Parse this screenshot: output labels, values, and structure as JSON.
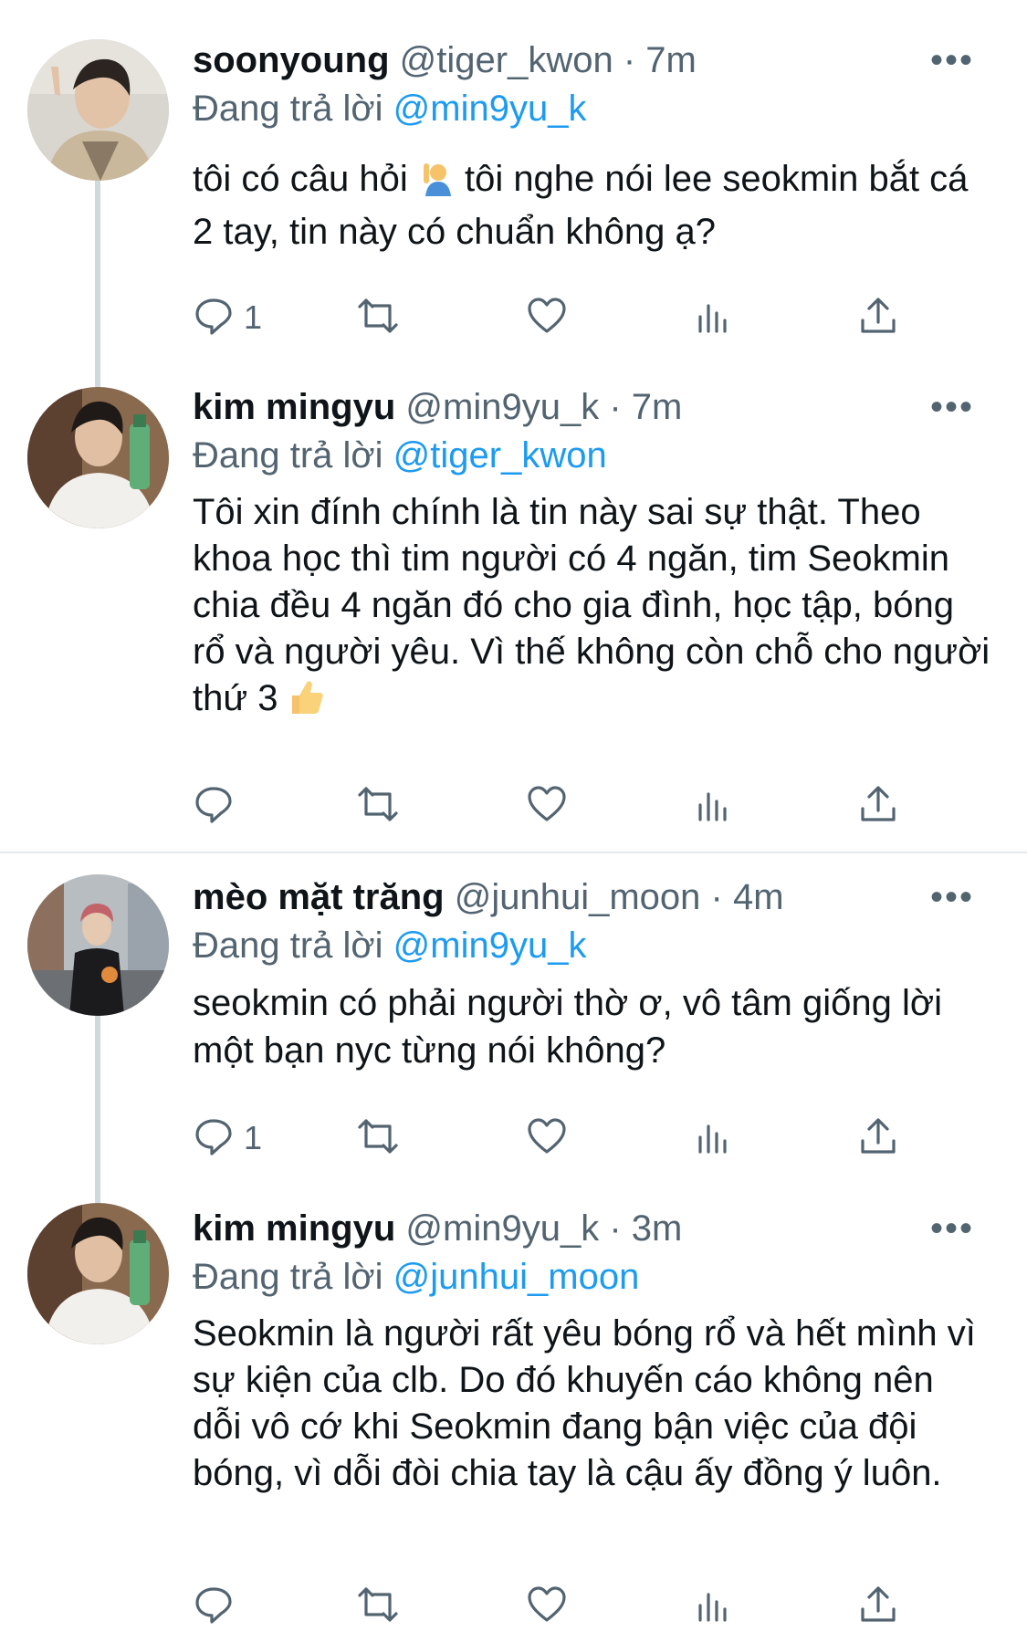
{
  "tweets": [
    {
      "name": "soonyoung",
      "handle": "@tiger_kwon",
      "sep": "·",
      "time": "7m",
      "reply_prefix": "Đang trả lời",
      "reply_to": "@min9yu_k",
      "text_a": "tôi có câu hỏi",
      "text_b": " tôi nghe nói lee seokmin bắt cá 2 tay, tin này có chuẩn không ạ?",
      "emoji": "person-raising-hand-emoji",
      "reply_count": "1",
      "more": "•••"
    },
    {
      "name": "kim mingyu",
      "handle": "@min9yu_k",
      "sep": "·",
      "time": "7m",
      "reply_prefix": "Đang trả lời",
      "reply_to": "@tiger_kwon",
      "text_a": "Tôi xin đính chính là tin này sai sự thật. Theo khoa học thì tim người có 4 ngăn, tim Seokmin chia đều 4 ngăn đó cho gia đình, học tập, bóng rổ và người yêu. Vì thế không còn chỗ cho người thứ 3",
      "text_b": "",
      "emoji": "thumbs-up-emoji",
      "reply_count": "",
      "more": "•••"
    },
    {
      "name": "mèo mặt trăng",
      "handle": "@junhui_moon",
      "sep": "·",
      "time": "4m",
      "reply_prefix": "Đang trả lời",
      "reply_to": "@min9yu_k",
      "text_a": "seokmin có phải người thờ ơ, vô tâm giống lời một bạn nyc từng nói không?",
      "text_b": "",
      "emoji": "",
      "reply_count": "1",
      "more": "•••"
    },
    {
      "name": "kim mingyu",
      "handle": "@min9yu_k",
      "sep": "·",
      "time": "3m",
      "reply_prefix": "Đang trả lời",
      "reply_to": "@junhui_moon",
      "text_a": "Seokmin là người rất yêu bóng rổ và hết mình vì sự kiện của clb. Do đó khuyến cáo không nên dỗi vô cớ khi Seokmin đang bận việc của đội bóng, vì dỗi đòi chia tay là cậu ấy đồng ý luôn.",
      "text_b": "",
      "emoji": "",
      "reply_count": "",
      "more": "•••"
    }
  ],
  "icons": [
    "reply-icon",
    "retweet-icon",
    "like-icon",
    "analytics-icon",
    "share-icon"
  ]
}
